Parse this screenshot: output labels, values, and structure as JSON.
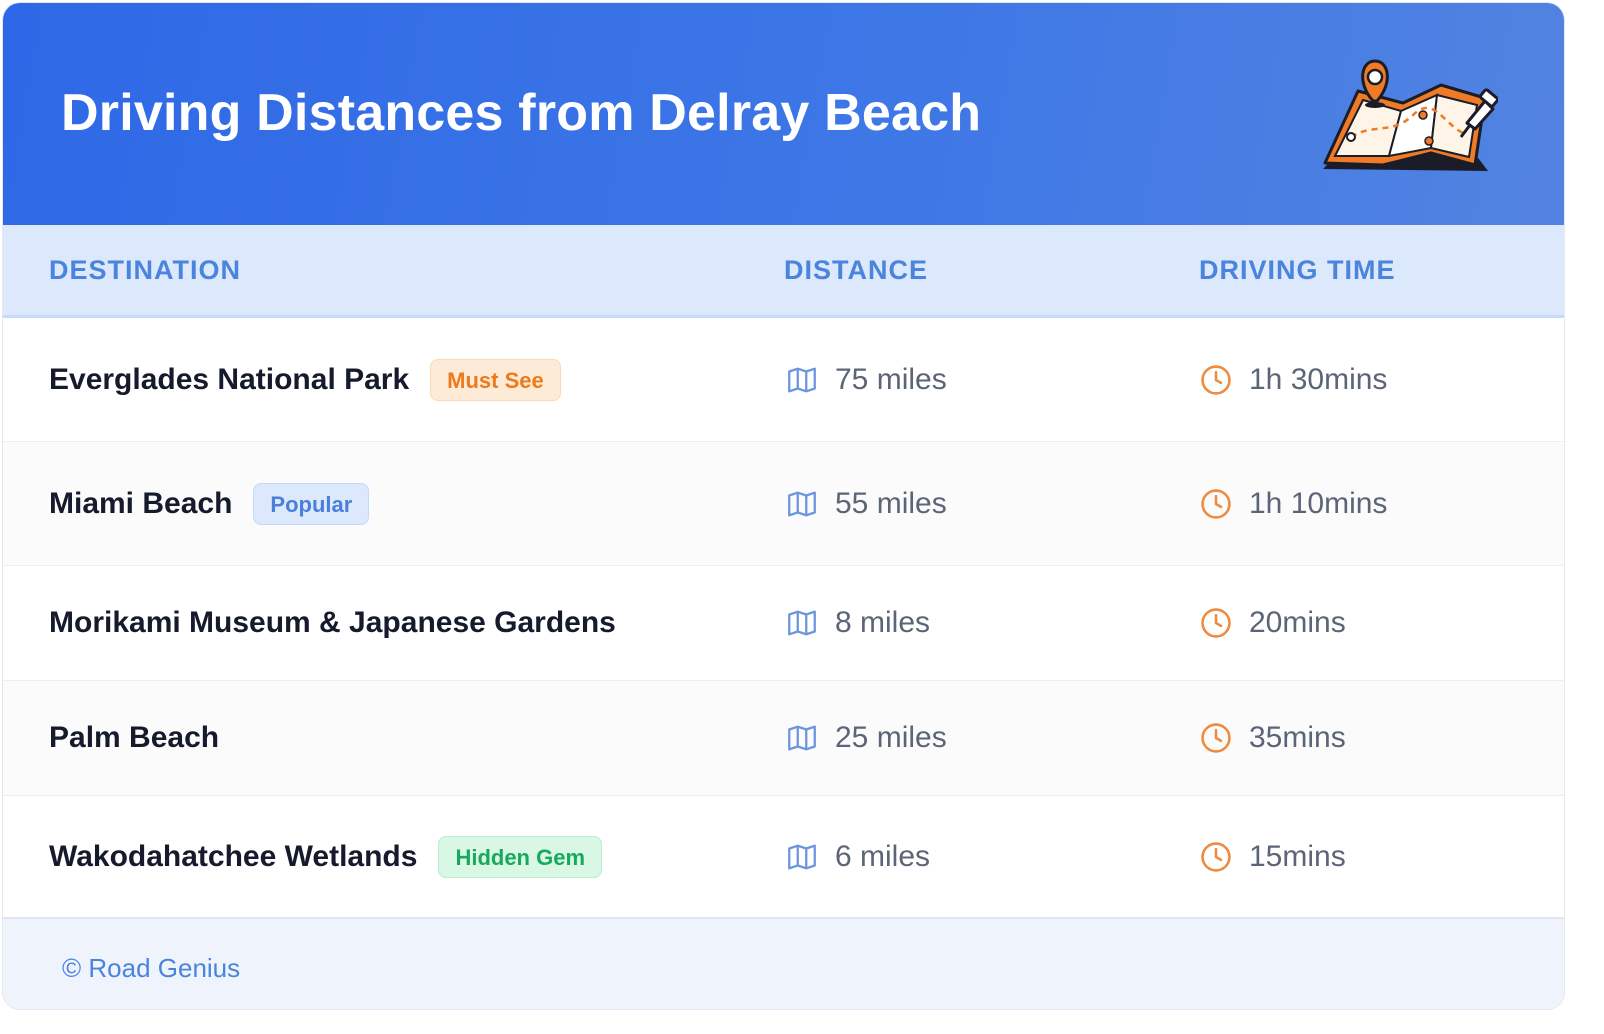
{
  "header": {
    "title": "Driving Distances from Delray Beach",
    "colors": {
      "gradient_start": "#2e68e6",
      "gradient_end": "#5283e0"
    },
    "illustration_icon": "map-with-pin-icon"
  },
  "table": {
    "columns": [
      "DESTINATION",
      "DISTANCE",
      "DRIVING TIME"
    ],
    "distance_icon": "map-icon",
    "time_icon": "clock-icon",
    "rows": [
      {
        "destination": "Everglades National Park",
        "badge": "Must See",
        "distance": "75 miles",
        "time": "1h 30mins"
      },
      {
        "destination": "Miami Beach",
        "badge": "Popular",
        "distance": "55 miles",
        "time": "1h 10mins"
      },
      {
        "destination": "Morikami Museum & Japanese Gardens",
        "badge": null,
        "distance": "8 miles",
        "time": "20mins"
      },
      {
        "destination": "Palm Beach",
        "badge": null,
        "distance": "25 miles",
        "time": "35mins"
      },
      {
        "destination": "Wakodahatchee Wetlands",
        "badge": "Hidden Gem",
        "distance": "6 miles",
        "time": "15mins"
      }
    ]
  },
  "footer": {
    "text": "© Road Genius"
  },
  "colors": {
    "badge_must_see": "#ee7a1d",
    "badge_popular": "#4a80dc",
    "badge_hidden_gem": "#1aa85c",
    "accent_blue": "#4a84dc",
    "accent_orange": "#f08a3e"
  }
}
